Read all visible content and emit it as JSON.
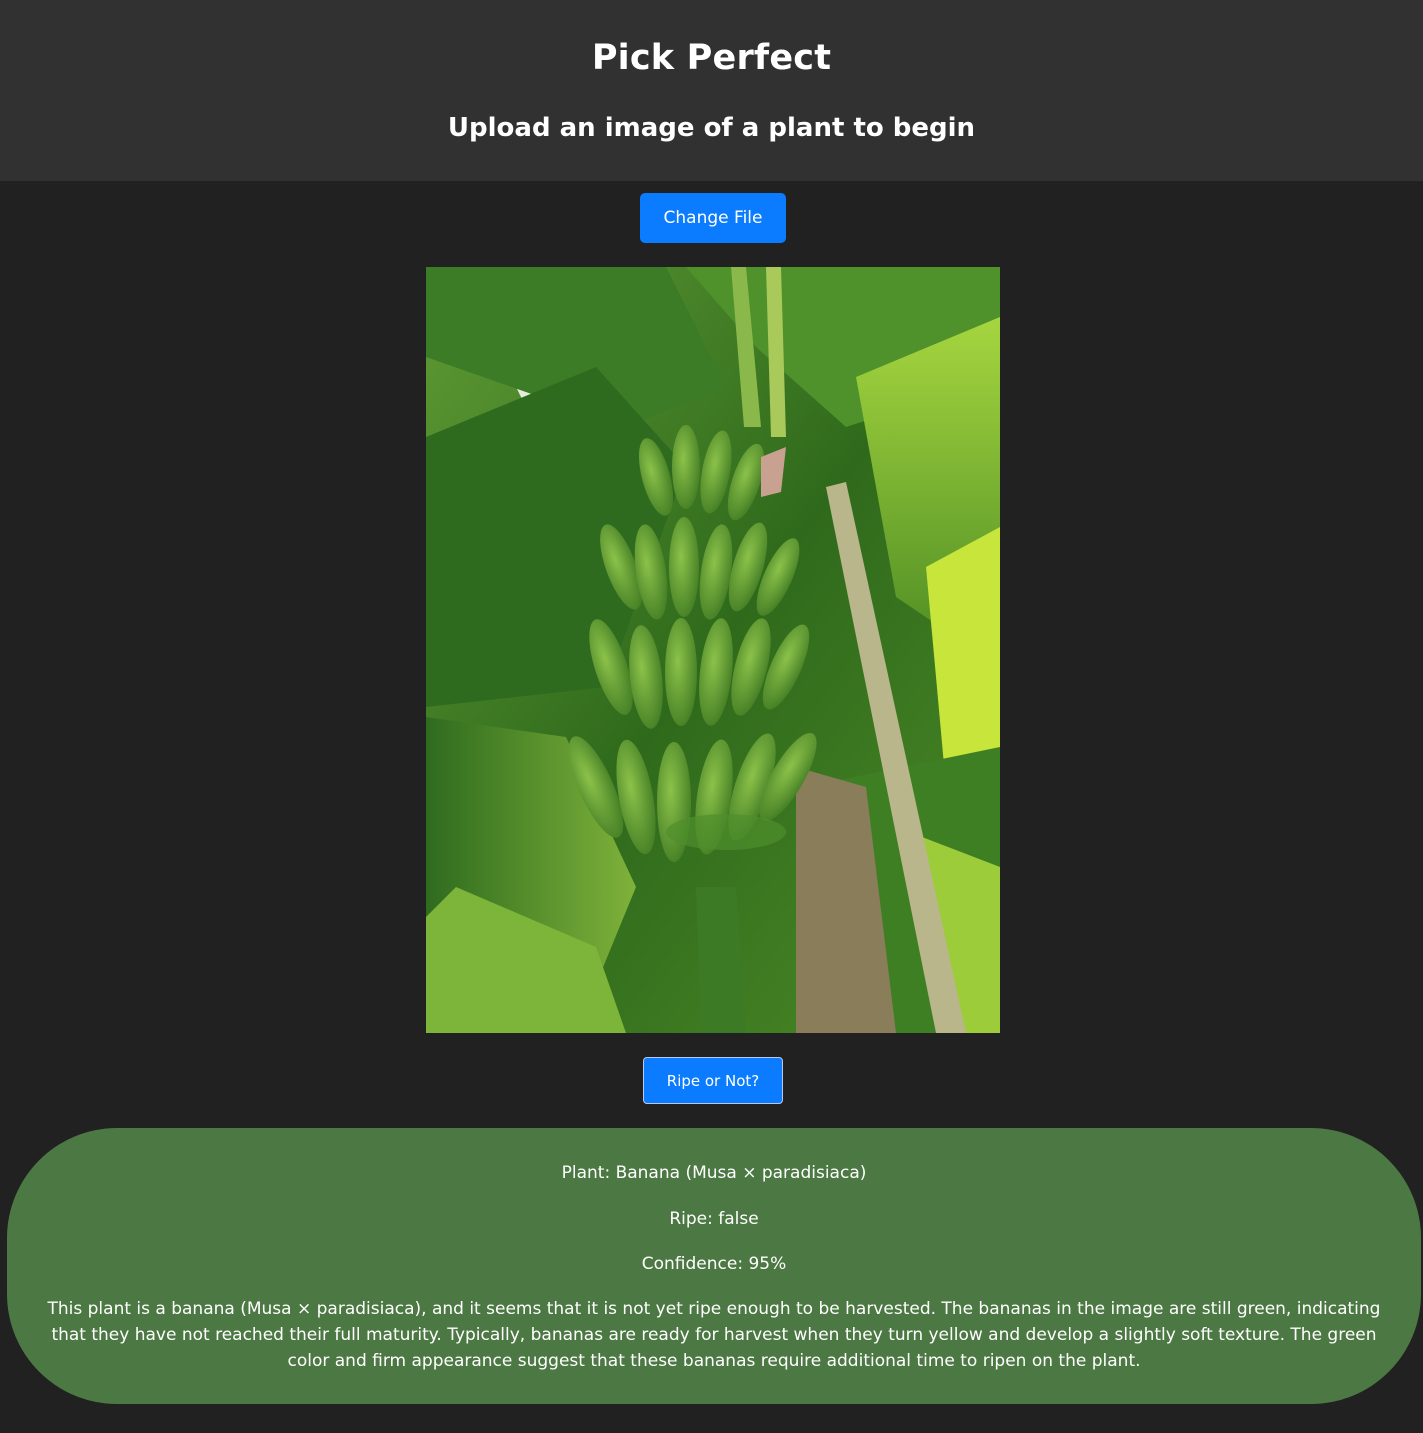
{
  "header": {
    "title": "Pick Perfect",
    "subtitle": "Upload an image of a plant to begin"
  },
  "actions": {
    "change_file_label": "Change File",
    "ripe_button_label": "Ripe or Not?"
  },
  "preview": {
    "alt": "Green bananas hanging on a banana plant"
  },
  "result": {
    "plant": "Plant: Banana (Musa × paradisiaca)",
    "ripe": "Ripe: false",
    "confidence": "Confidence: 95%",
    "description": "This plant is a banana (Musa × paradisiaca), and it seems that it is not yet ripe enough to be harvested. The bananas in the image are still green, indicating that they have not reached their full maturity. Typically, bananas are ready for harvest when they turn yellow and develop a slightly soft texture. The green color and firm appearance suggest that these bananas require additional time to ripen on the plant."
  },
  "colors": {
    "page_bg": "#212121",
    "header_bg": "#313131",
    "button_blue": "#0b7cff",
    "result_bg": "#4c7843"
  }
}
